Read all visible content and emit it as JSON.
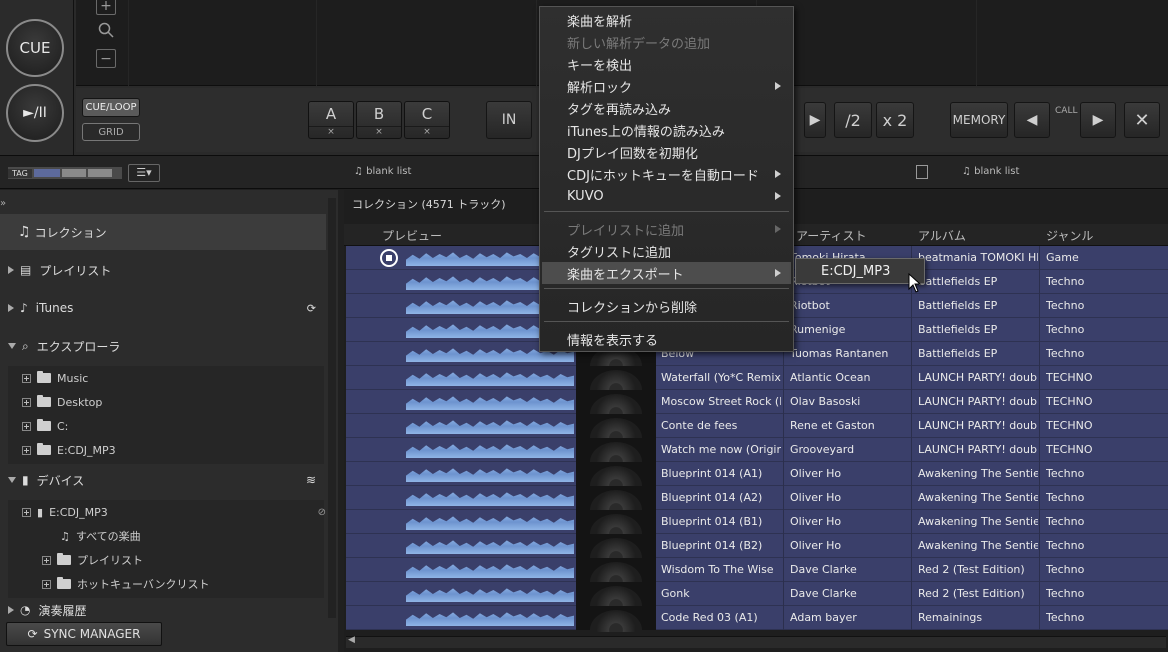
{
  "deck": {
    "cue_label": "CUE",
    "play_label": "►/II",
    "cue_loop_label": "CUE/LOOP",
    "grid_label": "GRID",
    "hotcues": [
      {
        "label": "A",
        "sub": "×"
      },
      {
        "label": "B",
        "sub": "×"
      },
      {
        "label": "C",
        "sub": "×"
      }
    ],
    "in_label": "IN",
    "half_label": "/2",
    "double_label": "x 2",
    "memory_label": "MEMORY",
    "call_label": "CALL"
  },
  "strip": {
    "tag_label": "TAG",
    "left_list_label": "blank list",
    "right_list_label": "blank list"
  },
  "sidebar": {
    "collection": "コレクション",
    "playlists": "プレイリスト",
    "itunes": "iTunes",
    "explorer": "エクスプローラ",
    "explorer_items": [
      "Music",
      "Desktop",
      "C:",
      "E:CDJ_MP3"
    ],
    "devices": "デバイス",
    "device_name": "E:CDJ_MP3",
    "device_items": [
      "すべての楽曲",
      "プレイリスト",
      "ホットキューバンクリスト"
    ],
    "history": "演奏履歴",
    "sync_manager": "SYNC MANAGER"
  },
  "list": {
    "title": "コレクション (4571 トラック)",
    "columns": {
      "preview": "プレビュー",
      "artist": "アーティスト",
      "album": "アルバム",
      "genre": "ジャンル"
    },
    "rows": [
      {
        "title": "",
        "artist": "Tomoki Hirata",
        "album": "beatmania TOMOKI HIR",
        "genre": "Game"
      },
      {
        "title": "",
        "artist": "Riotbot",
        "album": "Battlefields EP",
        "genre": "Techno"
      },
      {
        "title": "",
        "artist": "Riotbot",
        "album": "Battlefields EP",
        "genre": "Techno"
      },
      {
        "title": "",
        "artist": "Rumenige",
        "album": "Battlefields EP",
        "genre": "Techno"
      },
      {
        "title": "Below",
        "artist": "Tuomas Rantanen",
        "album": "Battlefields EP",
        "genre": "Techno"
      },
      {
        "title": "Waterfall (Yo*C Remix)",
        "artist": "Atlantic Ocean",
        "album": "LAUNCH PARTY! doubl",
        "genre": "TECHNO"
      },
      {
        "title": "Moscow Street Rock (Ha",
        "artist": "Olav Basoski",
        "album": "LAUNCH PARTY! doubl",
        "genre": "TECHNO"
      },
      {
        "title": "Conte de fees",
        "artist": "Rene et Gaston",
        "album": "LAUNCH PARTY! doubl",
        "genre": "TECHNO"
      },
      {
        "title": "Watch me now (Original",
        "artist": "Grooveyard",
        "album": "LAUNCH PARTY! doubl",
        "genre": "TECHNO"
      },
      {
        "title": "Blueprint 014 (A1)",
        "artist": "Oliver Ho",
        "album": "Awakening The Sentient",
        "genre": "Techno"
      },
      {
        "title": "Blueprint 014 (A2)",
        "artist": "Oliver Ho",
        "album": "Awakening The Sentient",
        "genre": "Techno"
      },
      {
        "title": "Blueprint 014 (B1)",
        "artist": "Oliver Ho",
        "album": "Awakening The Sentient",
        "genre": "Techno"
      },
      {
        "title": "Blueprint 014 (B2)",
        "artist": "Oliver Ho",
        "album": "Awakening The Sentient",
        "genre": "Techno"
      },
      {
        "title": "Wisdom To The Wise",
        "artist": "Dave Clarke",
        "album": "Red 2 (Test Edition)",
        "genre": "Techno"
      },
      {
        "title": "Gonk",
        "artist": "Dave Clarke",
        "album": "Red 2 (Test Edition)",
        "genre": "Techno"
      },
      {
        "title": "Code Red 03 (A1)",
        "artist": "Adam bayer",
        "album": "Remainings",
        "genre": "Techno"
      }
    ]
  },
  "context_menu": {
    "items": [
      {
        "label": "楽曲を解析",
        "disabled": false,
        "sub": false
      },
      {
        "label": "新しい解析データの追加",
        "disabled": true,
        "sub": false
      },
      {
        "label": "キーを検出",
        "disabled": false,
        "sub": false
      },
      {
        "label": "解析ロック",
        "disabled": false,
        "sub": true
      },
      {
        "label": "タグを再読み込み",
        "disabled": false,
        "sub": false
      },
      {
        "label": "iTunes上の情報の読み込み",
        "disabled": false,
        "sub": false
      },
      {
        "label": "DJプレイ回数を初期化",
        "disabled": false,
        "sub": false
      },
      {
        "label": "CDJにホットキューを自動ロード",
        "disabled": false,
        "sub": true
      },
      {
        "label": "KUVO",
        "disabled": false,
        "sub": true
      },
      {
        "label": "プレイリストに追加",
        "disabled": true,
        "sub": true
      },
      {
        "label": "タグリストに追加",
        "disabled": false,
        "sub": false
      },
      {
        "label": "楽曲をエクスポート",
        "disabled": false,
        "sub": true,
        "highlight": true
      },
      {
        "label": "コレクションから削除",
        "disabled": false,
        "sub": false
      },
      {
        "label": "情報を表示する",
        "disabled": false,
        "sub": false
      }
    ],
    "submenu_label": "E:CDJ_MP3"
  },
  "colors": {
    "row_bg": "#3a3f6a",
    "menu_bg": "#2b2b2b",
    "accent": "#6d93cf"
  }
}
